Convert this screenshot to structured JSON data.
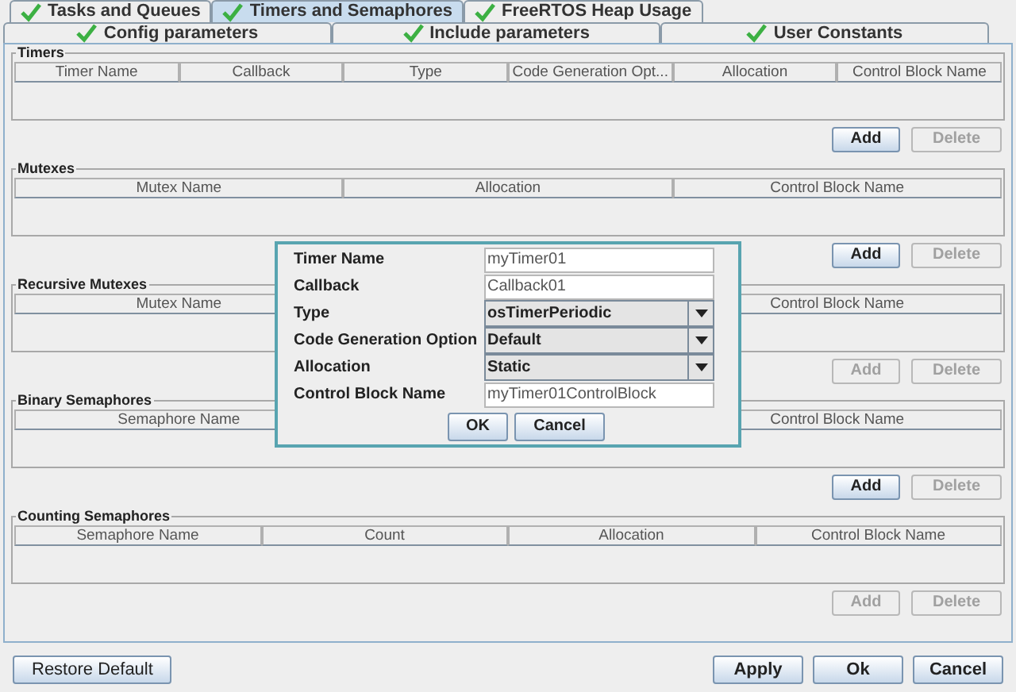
{
  "tabs_row_1": [
    {
      "label": "Tasks and Queues",
      "selected": false
    },
    {
      "label": "Timers and Semaphores",
      "selected": true
    },
    {
      "label": "FreeRTOS Heap Usage",
      "selected": false
    }
  ],
  "tabs_row_2": [
    {
      "label": "Config parameters",
      "selected": false
    },
    {
      "label": "Include parameters",
      "selected": false
    },
    {
      "label": "User Constants",
      "selected": false
    }
  ],
  "sections": [
    {
      "title": "Timers",
      "columns": [
        "Timer Name",
        "Callback",
        "Type",
        "Code Generation Opt...",
        "Allocation",
        "Control Block Name"
      ],
      "buttons": [
        {
          "label": "Add",
          "disabled": false
        },
        {
          "label": "Delete",
          "disabled": true
        }
      ]
    },
    {
      "title": "Mutexes",
      "columns": [
        "Mutex Name",
        "Allocation",
        "Control Block Name"
      ],
      "buttons": [
        {
          "label": "Add",
          "disabled": false
        },
        {
          "label": "Delete",
          "disabled": true
        }
      ]
    },
    {
      "title": "Recursive Mutexes",
      "columns": [
        "Mutex Name",
        "Control Block Name"
      ],
      "buttons": [
        {
          "label": "Add",
          "disabled": true
        },
        {
          "label": "Delete",
          "disabled": true
        }
      ]
    },
    {
      "title": "Binary Semaphores",
      "columns": [
        "Semaphore Name",
        "Control Block Name"
      ],
      "buttons": [
        {
          "label": "Add",
          "disabled": false
        },
        {
          "label": "Delete",
          "disabled": true
        }
      ]
    },
    {
      "title": "Counting Semaphores",
      "columns": [
        "Semaphore Name",
        "Count",
        "Allocation",
        "Control Block Name"
      ],
      "buttons": [
        {
          "label": "Add",
          "disabled": true
        },
        {
          "label": "Delete",
          "disabled": true
        }
      ]
    }
  ],
  "footer": {
    "left": [
      "Restore Default"
    ],
    "right": [
      "Apply",
      "Ok",
      "Cancel"
    ]
  },
  "dialog": {
    "fields": [
      {
        "label": "Timer Name",
        "kind": "text",
        "value": "myTimer01"
      },
      {
        "label": "Callback",
        "kind": "text",
        "value": "Callback01"
      },
      {
        "label": "Type",
        "kind": "select",
        "value": "osTimerPeriodic"
      },
      {
        "label": "Code Generation Option",
        "kind": "select",
        "value": "Default"
      },
      {
        "label": "Allocation",
        "kind": "select",
        "value": "Static"
      },
      {
        "label": "Control Block Name",
        "kind": "text",
        "value": "myTimer01ControlBlock"
      }
    ],
    "buttons": [
      "OK",
      "Cancel"
    ]
  }
}
